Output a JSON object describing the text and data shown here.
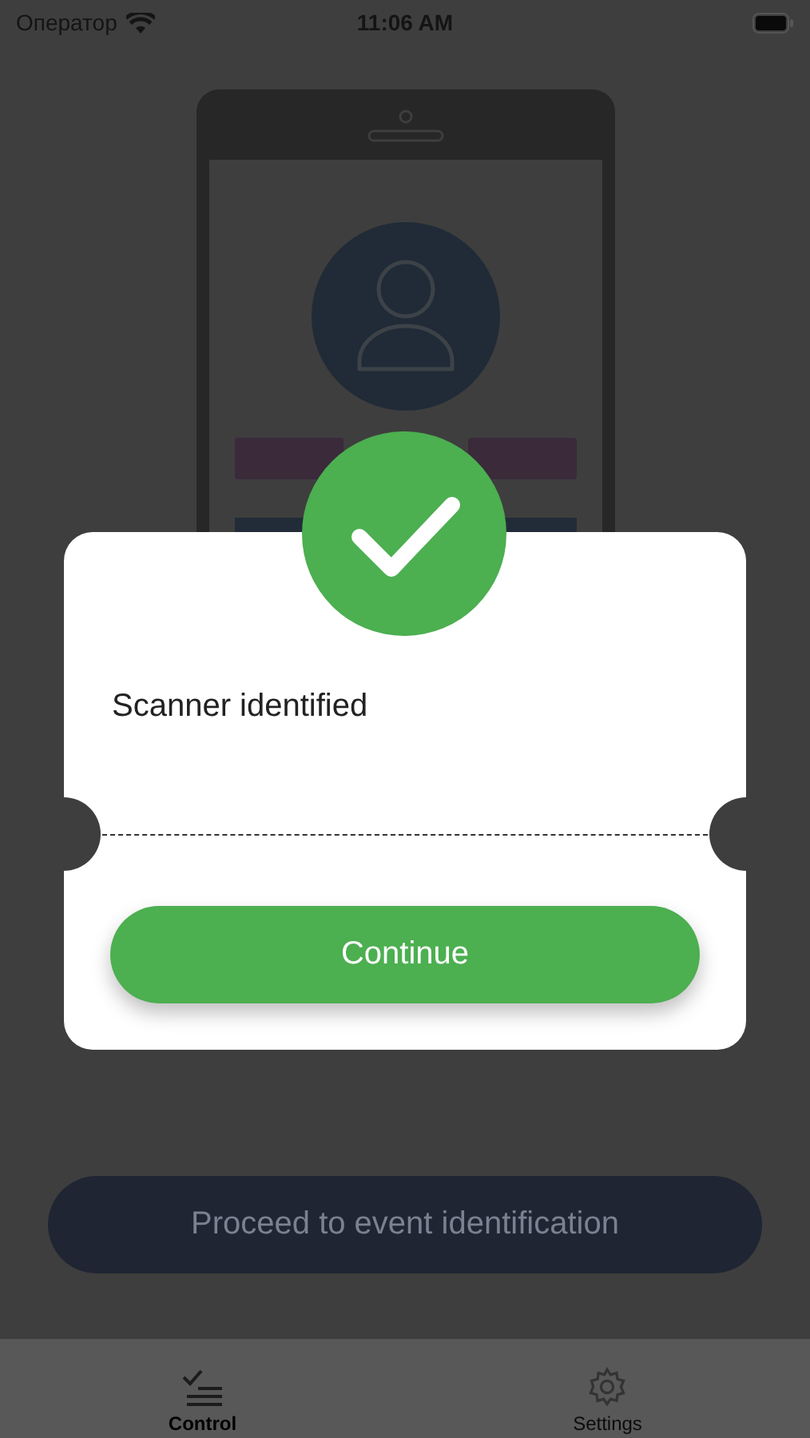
{
  "status_bar": {
    "carrier": "Оператор",
    "time": "11:06 AM"
  },
  "proceed_button": {
    "label": "Proceed to event identification"
  },
  "tabs": [
    {
      "label": "Control",
      "selected": true,
      "kind": "checklist"
    },
    {
      "label": "Settings",
      "selected": false,
      "kind": "gear"
    }
  ],
  "dialog": {
    "message": "Scanner identified",
    "button": "Continue"
  }
}
